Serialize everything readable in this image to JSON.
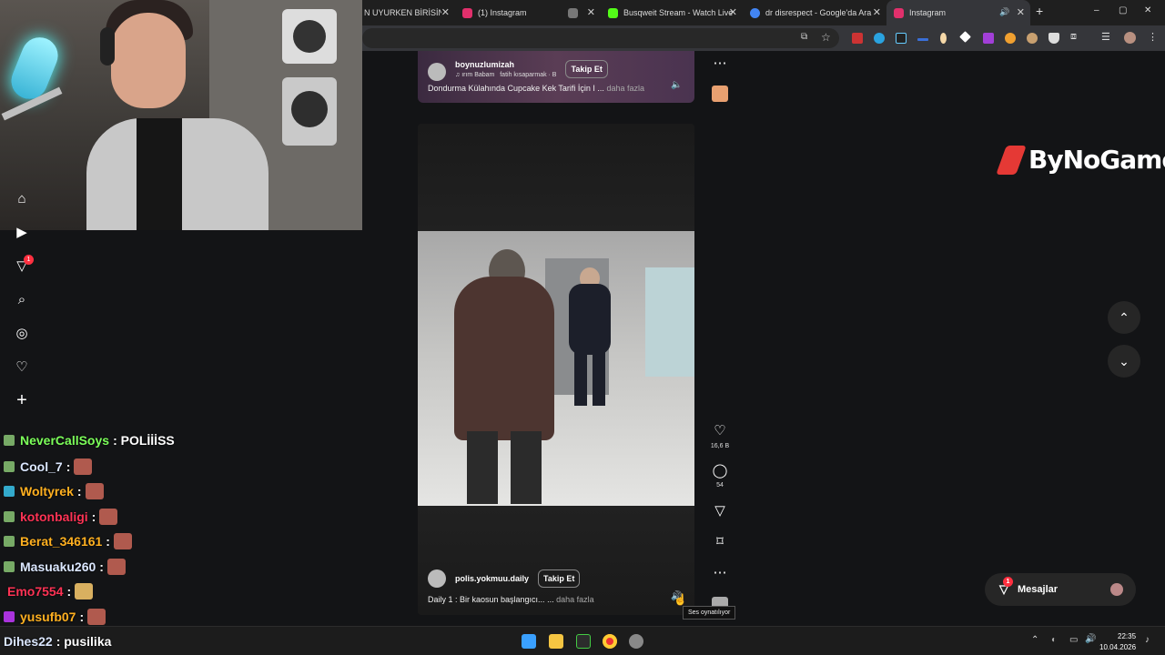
{
  "browser": {
    "tabs": [
      {
        "title": "N UYURKEN BİRİSİNİ (",
        "color": "#ffffff"
      },
      {
        "title": "(1) Instagram",
        "color": "#e1306c"
      },
      {
        "title": "",
        "color": "#bbbbbb"
      },
      {
        "title": "Busqweit Stream - Watch Live o",
        "color": "#53fc18"
      },
      {
        "title": "dr disrespect - Google'da Ara",
        "color": "#4285f4"
      },
      {
        "title": "Instagram",
        "color": "#e1306c"
      }
    ],
    "new_tab": "+",
    "window_buttons": [
      "–",
      "▢",
      "✕"
    ]
  },
  "left_nav": {
    "items": [
      "home-icon",
      "reels-icon",
      "messages-icon",
      "search-icon",
      "explore-icon",
      "notifications-icon",
      "create-icon"
    ],
    "messages_badge": "1"
  },
  "top_reel": {
    "username": "boynuzlumizah",
    "audio": "ırım Babam",
    "audio2": "fatih kısaparmak · B",
    "follow": "Takip Et",
    "caption": "Dondurma Külahında Cupcake Kek Tarifi İçin I ...",
    "more": "daha fazla"
  },
  "main_reel": {
    "username": "polis.yokmuu.daily",
    "follow": "Takip Et",
    "caption": "Daily 1 : Bir kaosun başlangıcı... ...",
    "more": "daha fazla",
    "likes": "16,6 B",
    "comments": "54",
    "tooltip": "Ses oynatılıyor"
  },
  "brand": {
    "name": "ByNoGame",
    "color": "#e53935"
  },
  "messages_pill": {
    "label": "Mesajlar",
    "badge": "1"
  },
  "chat": [
    {
      "user": "NeverCallSoys",
      "msg": ": POLİİİSS",
      "color": "#7cff5a"
    },
    {
      "user": "Cool_7",
      "msg": ":",
      "color": "#dbe7ff"
    },
    {
      "user": "Woltyrek",
      "msg": ":",
      "color": "#ffb020"
    },
    {
      "user": "kotonbaligi",
      "msg": ":",
      "color": "#ff3355"
    },
    {
      "user": "Berat_346161",
      "msg": ":",
      "color": "#ffb020"
    },
    {
      "user": "Masuaku260",
      "msg": ":",
      "color": "#dbe7ff"
    },
    {
      "user": "Emo7554",
      "msg": ":",
      "color": "#ff3355"
    },
    {
      "user": "yusufb07",
      "msg": ":",
      "color": "#ffb020"
    },
    {
      "user": "Dihes22",
      "msg": ": pusilika",
      "color": "#dbe7ff"
    }
  ],
  "taskbar": {
    "time": "22:35",
    "date": "10.04.2026"
  }
}
